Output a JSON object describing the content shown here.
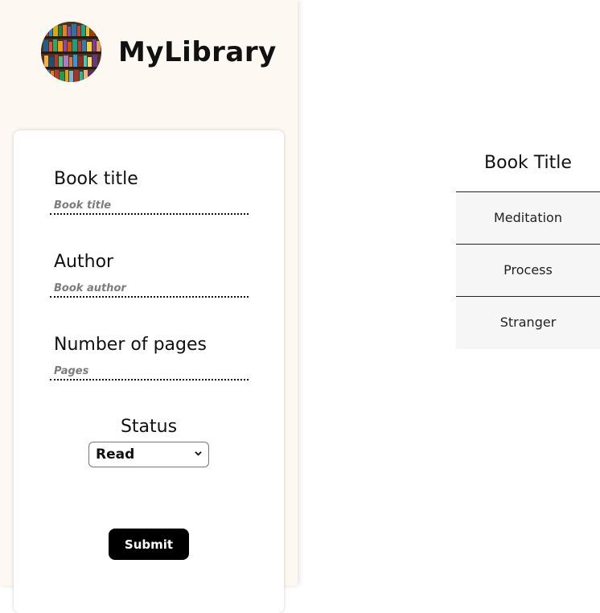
{
  "brand": {
    "name": "MyLibrary",
    "logo_icon": "bookshelf-logo"
  },
  "form": {
    "title_label": "Book title",
    "title_placeholder": "Book title",
    "author_label": "Author",
    "author_placeholder": "Book author",
    "pages_label": "Number of pages",
    "pages_placeholder": "Pages",
    "status_label": "Status",
    "status_value": "Read",
    "submit_label": "Submit"
  },
  "table": {
    "header": "Book Title",
    "rows": [
      "Meditation",
      "Process",
      "Stranger"
    ]
  },
  "colors": {
    "sidebar_bg": "#fdf8f1",
    "button_bg": "#000000",
    "row_bg": "#f6f6f6"
  }
}
